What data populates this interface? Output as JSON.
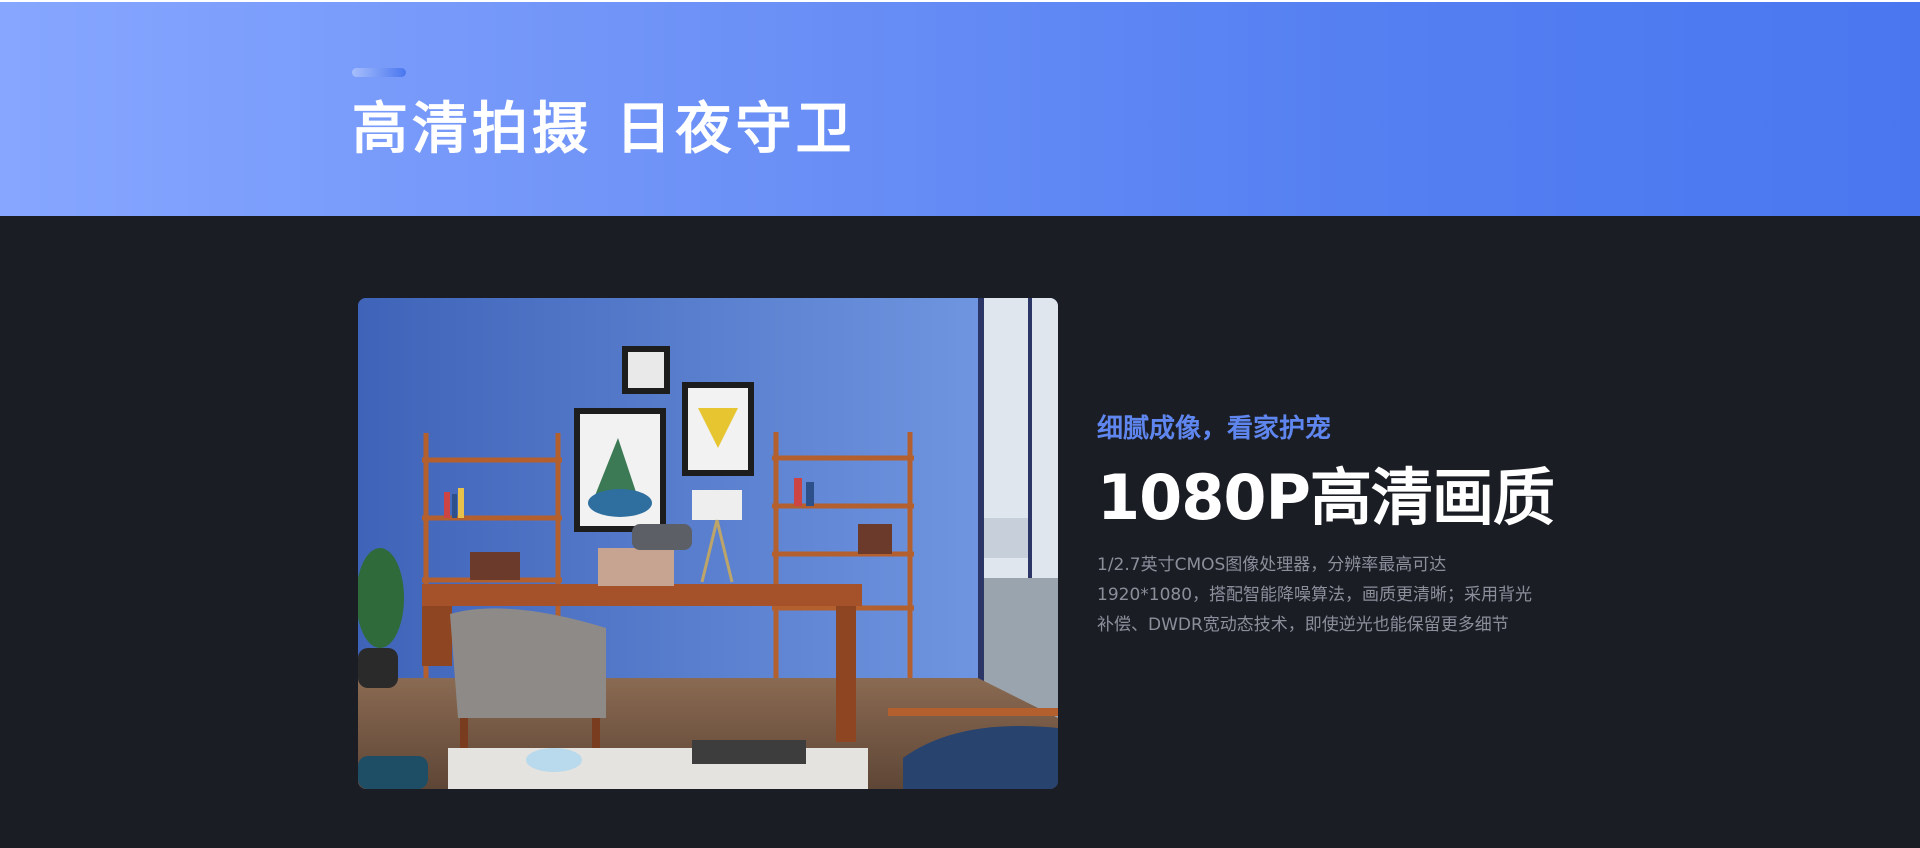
{
  "banner": {
    "title": "高清拍摄 日夜守卫"
  },
  "feature": {
    "kicker": "细腻成像，看家护宠",
    "heading": "1080P高清画质",
    "description_lines": [
      "1/2.7英寸CMOS图像处理器，分辨率最高可达",
      "1920*1080，搭配智能降噪算法，画质更清晰；采用背光",
      "补偿、DWDR宽动态技术，即使逆光也能保留更多细节"
    ]
  },
  "colors": {
    "banner_start": "#86a6ff",
    "banner_end": "#4a77f0",
    "page_background": "#1b1d25",
    "kicker": "#5e86ee",
    "heading": "#ffffff",
    "description": "#8b8f9a"
  }
}
